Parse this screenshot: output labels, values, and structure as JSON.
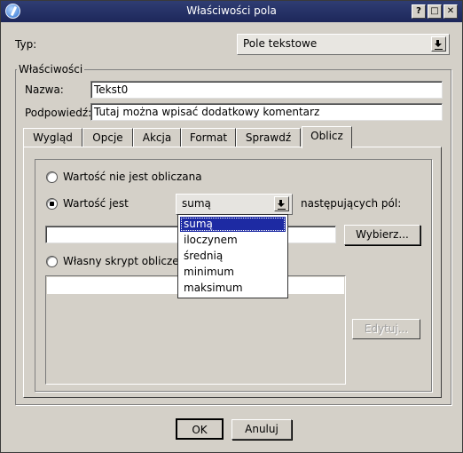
{
  "window": {
    "title": "Właściwości pola"
  },
  "titlebar_buttons": {
    "help": "?",
    "maximize": "□",
    "close": "✕"
  },
  "type_row": {
    "label": "Typ:",
    "value": "Pole tekstowe"
  },
  "properties_group": {
    "title": "Właściwości",
    "name_label": "Nazwa:",
    "name_value": "Tekst0",
    "hint_label": "Podpowiedź:",
    "hint_value": "Tutaj można wpisać dodatkowy komentarz"
  },
  "tabs": [
    {
      "label": "Wygląd"
    },
    {
      "label": "Opcje"
    },
    {
      "label": "Akcja"
    },
    {
      "label": "Format"
    },
    {
      "label": "Sprawdź"
    },
    {
      "label": "Oblicz",
      "active": true
    }
  ],
  "calculate_tab": {
    "radio_not_calculated": "Wartość nie jest obliczana",
    "radio_calculated": "Wartość jest",
    "function_combo_value": "sumą",
    "following_fields_label": "następujących pól:",
    "fields_value": "",
    "choose_button": "Wybierz...",
    "radio_custom_script": "Własny skrypt obliczeni",
    "edit_button": "Edytuj...",
    "selected_radio": "calculated"
  },
  "function_dropdown": {
    "options": [
      "sumą",
      "iloczynem",
      "średnią",
      "minimum",
      "maksimum"
    ],
    "highlighted_index": 0
  },
  "footer": {
    "ok": "OK",
    "cancel": "Anuluj"
  }
}
